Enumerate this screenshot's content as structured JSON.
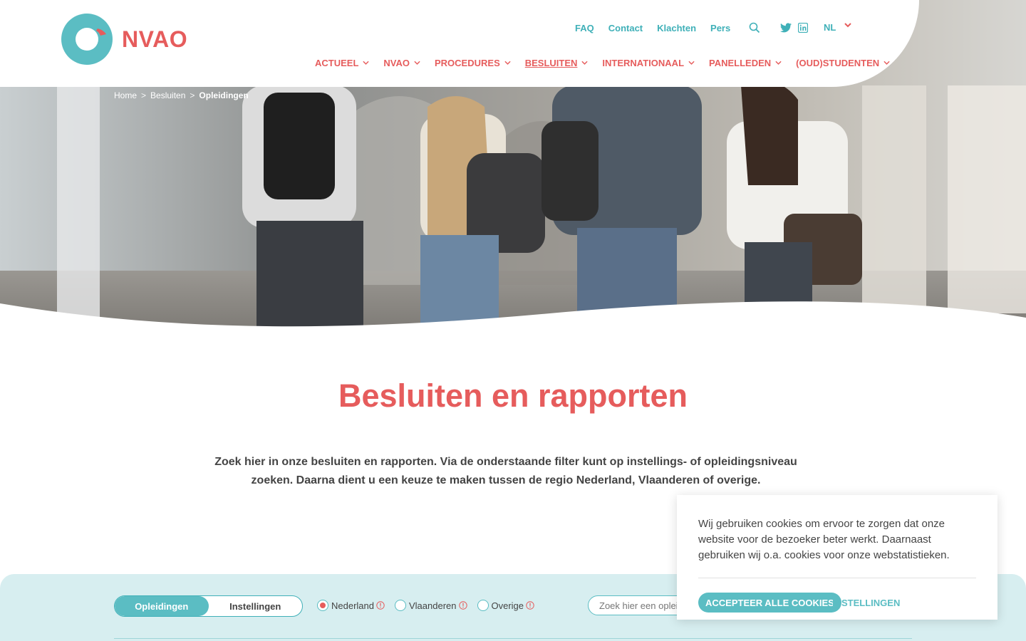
{
  "brand": {
    "name": "NVAO",
    "accent": "#e65c5c",
    "teal": "#3fb0b8"
  },
  "topnav": {
    "links": [
      "FAQ",
      "Contact",
      "Klachten",
      "Pers"
    ],
    "icons": [
      "search-icon",
      "twitter-icon",
      "linkedin-icon"
    ],
    "language": "NL"
  },
  "mainnav": {
    "items": [
      "ACTUEEL",
      "NVAO",
      "PROCEDURES",
      "BESLUITEN",
      "INTERNATIONAAL",
      "PANELLEDEN",
      "(OUD)STUDENTEN"
    ],
    "active": "BESLUITEN"
  },
  "breadcrumb": {
    "home": "Home",
    "level1": "Besluiten",
    "current": "Opleidingen",
    "separator": ">"
  },
  "page": {
    "title": "Besluiten en rapporten",
    "intro": "Zoek hier in onze besluiten en rapporten. Via de onderstaande filter kunt op instellings- of opleidingsniveau zoeken. Daarna dient u een keuze te maken tussen de regio Nederland, Vlaanderen of overige."
  },
  "filter": {
    "toggle": [
      "Opleidingen",
      "Instellingen"
    ],
    "toggle_selected": "Opleidingen",
    "regions": [
      "Nederland",
      "Vlaanderen",
      "Overige"
    ],
    "region_selected": "Nederland",
    "search_placeholder": "Zoek hier een opleiding"
  },
  "cookie": {
    "text": "Wij gebruiken cookies om ervoor te zorgen dat onze website voor de bezoeker beter werkt. Daarnaast gebruiken wij o.a. cookies voor onze webstatistieken.",
    "accept": "ACCEPTEER ALLE COOKIES",
    "settings": "INSTELLINGEN"
  }
}
